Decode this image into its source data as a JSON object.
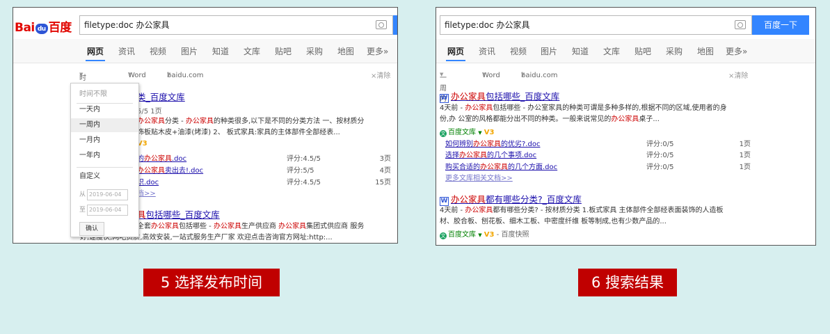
{
  "left": {
    "logo": {
      "bai": "Bai",
      "du": "du",
      "cn": "百度"
    },
    "search": {
      "value": "filetype:doc 办公家具"
    },
    "tabs": [
      "网页",
      "资讯",
      "视频",
      "图片",
      "知道",
      "文库",
      "贴吧",
      "采购",
      "地图",
      "更多»"
    ],
    "filters": {
      "time": "时间不限",
      "type": "Word",
      "site": "baidu.com",
      "clear": "×清除"
    },
    "dropdown": {
      "items": [
        "时间不限",
        "一天内",
        "一周内",
        "一月内",
        "一年内"
      ],
      "custom": "自定义",
      "from_label": "从",
      "from_value": "2019-06-04",
      "to_label": "至",
      "to_value": "2019-06-04",
      "confirm": "确认"
    },
    "result1": {
      "title_tail": "类_百度文库",
      "meta": "5/5 1页",
      "line1_a": "办公家具",
      "line1_b": "分类 - ",
      "line1_c": "办公家具",
      "line1_d": "的种类很多,以下是不同的分类方法 一、按材质分",
      "line2": "饰板贴木皮+油漆(烤漆) 2、 板式家具:家具的主体部件全部经表...",
      "line3": "V3",
      "docs": [
        {
          "pre": "的",
          "em": "办公家具",
          "post": ".doc",
          "score": "评分:4.5/5",
          "pages": "3页"
        },
        {
          "pre": "",
          "em": "办公家具",
          "post": "卖出去!.doc",
          "score": "评分:5/5",
          "pages": "4页"
        },
        {
          "pre": "识.doc",
          "em": "",
          "post": "",
          "score": "评分:4.5/5",
          "pages": "15页"
        }
      ],
      "more": "档>>"
    },
    "result2": {
      "title_em": "具",
      "title_rest": "包括哪些_百度文库",
      "line1_a": "全套",
      "line1_b": "办公家具",
      "line1_c": "包括哪些 - ",
      "line1_d": "办公家具",
      "line1_e": "生产供应商 ",
      "line1_f": "办公家具",
      "line1_g": "集团式供应商 服务",
      "line2": "好,速度快,网吧资质,高效安装,一站式服务生产厂家 欢迎点击咨询官方网址:http:..."
    }
  },
  "right": {
    "search": {
      "value": "filetype:doc 办公家具",
      "button": "百度一下"
    },
    "tabs": [
      "网页",
      "资讯",
      "视频",
      "图片",
      "知道",
      "文库",
      "贴吧",
      "采购",
      "地图",
      "更多»"
    ],
    "filters": {
      "time": "一周内",
      "type": "Word",
      "site": "baidu.com",
      "clear": "×清除"
    },
    "result1": {
      "w": "W",
      "title_em": "办公家具",
      "title_rest": "包括哪些_百度文库",
      "l1_a": "4天前 - ",
      "l1_b": "办公家具",
      "l1_c": "包括哪些 - 办公室家具的种类可谓是多种多样的,根据不同的区域,使用者的身",
      "l2_a": "份,办 公室的风格都能分出不同的种类。一般来说常见的",
      "l2_b": "办公家具",
      "l2_c": "桌子...",
      "source": "百度文库",
      "v": "V3",
      "docs": [
        {
          "pre": "如何辨别",
          "em": "办公家具",
          "post": "的优劣?.doc",
          "score": "评分:0/5",
          "pages": "1页"
        },
        {
          "pre": "选择",
          "em": "办公家具",
          "post": "的几个事项.doc",
          "score": "评分:0/5",
          "pages": "1页"
        },
        {
          "pre": "购买合适的",
          "em": "办公家具",
          "post": "的几个方面.doc",
          "score": "评分:0/5",
          "pages": "1页"
        }
      ],
      "more": "更多文库相关文档>>"
    },
    "result2": {
      "w": "W",
      "title_em": "办公家具",
      "title_rest": "都有哪些分类?_百度文库",
      "l1_a": "4天前 - ",
      "l1_b": "办公家具",
      "l1_c": "都有哪些分类? - 按材质分类 1.板式家具 主体部件全部经表面装饰的人造板",
      "l2": "材、胶合板、刨花板、细木工板、中密度纤维 板等制成,也有少数产品的...",
      "source": "百度文库",
      "v": "V3",
      "snapshot": "- 百度快照"
    }
  },
  "captions": [
    "5 选择发布时间",
    "6 搜索结果"
  ]
}
